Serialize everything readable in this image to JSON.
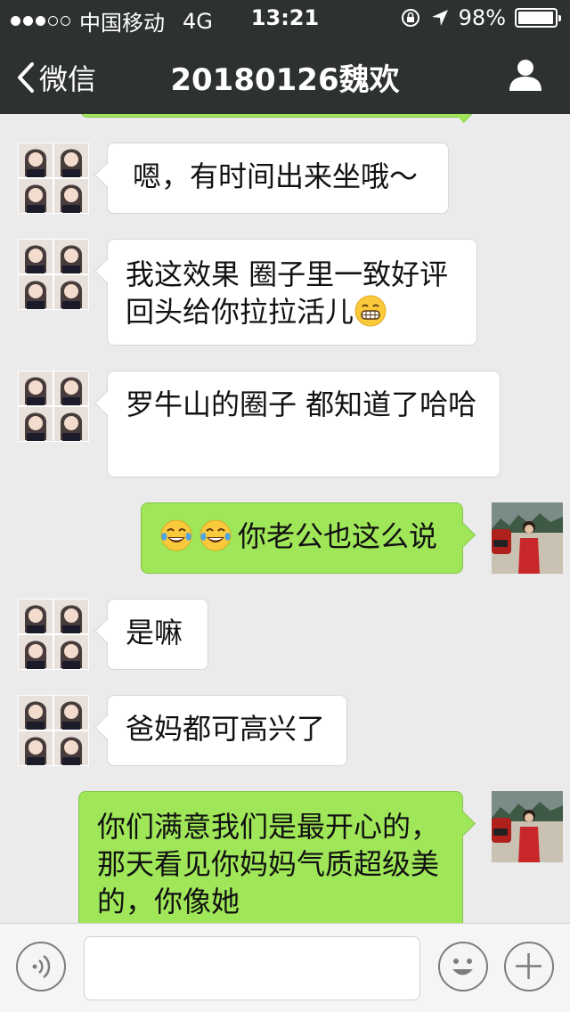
{
  "status_bar": {
    "carrier": "中国移动",
    "network": "4G",
    "time": "13:21",
    "battery": "98%",
    "battery_level": 0.98
  },
  "nav": {
    "back_label": "微信",
    "title": "20180126魏欢"
  },
  "messages": [
    {
      "text": "嗯，有时间出来坐哦～"
    },
    {
      "line1": "我这效果 圈子里一致好评",
      "line2": "回头给你拉拉活儿"
    },
    {
      "text": "罗牛山的圈子 都知道了哈哈"
    },
    {
      "text": "你老公也这么说"
    },
    {
      "text": "是嘛"
    },
    {
      "text": "爸妈都可高兴了"
    },
    {
      "line1": "你们满意我们是最开心的，",
      "line2": "那天看见你妈妈气质超级美",
      "line3": "的，你像她"
    }
  ],
  "colors": {
    "nav_bg": "#2e3132",
    "chat_bg": "#ebebeb",
    "outgoing_bubble": "#9fe658",
    "incoming_bubble": "#ffffff"
  },
  "icons": [
    "back-chevron-icon",
    "profile-icon",
    "voice-icon",
    "emoji-icon",
    "plus-icon",
    "grinning-emoji-icon",
    "tears-of-joy-emoji-icon"
  ]
}
